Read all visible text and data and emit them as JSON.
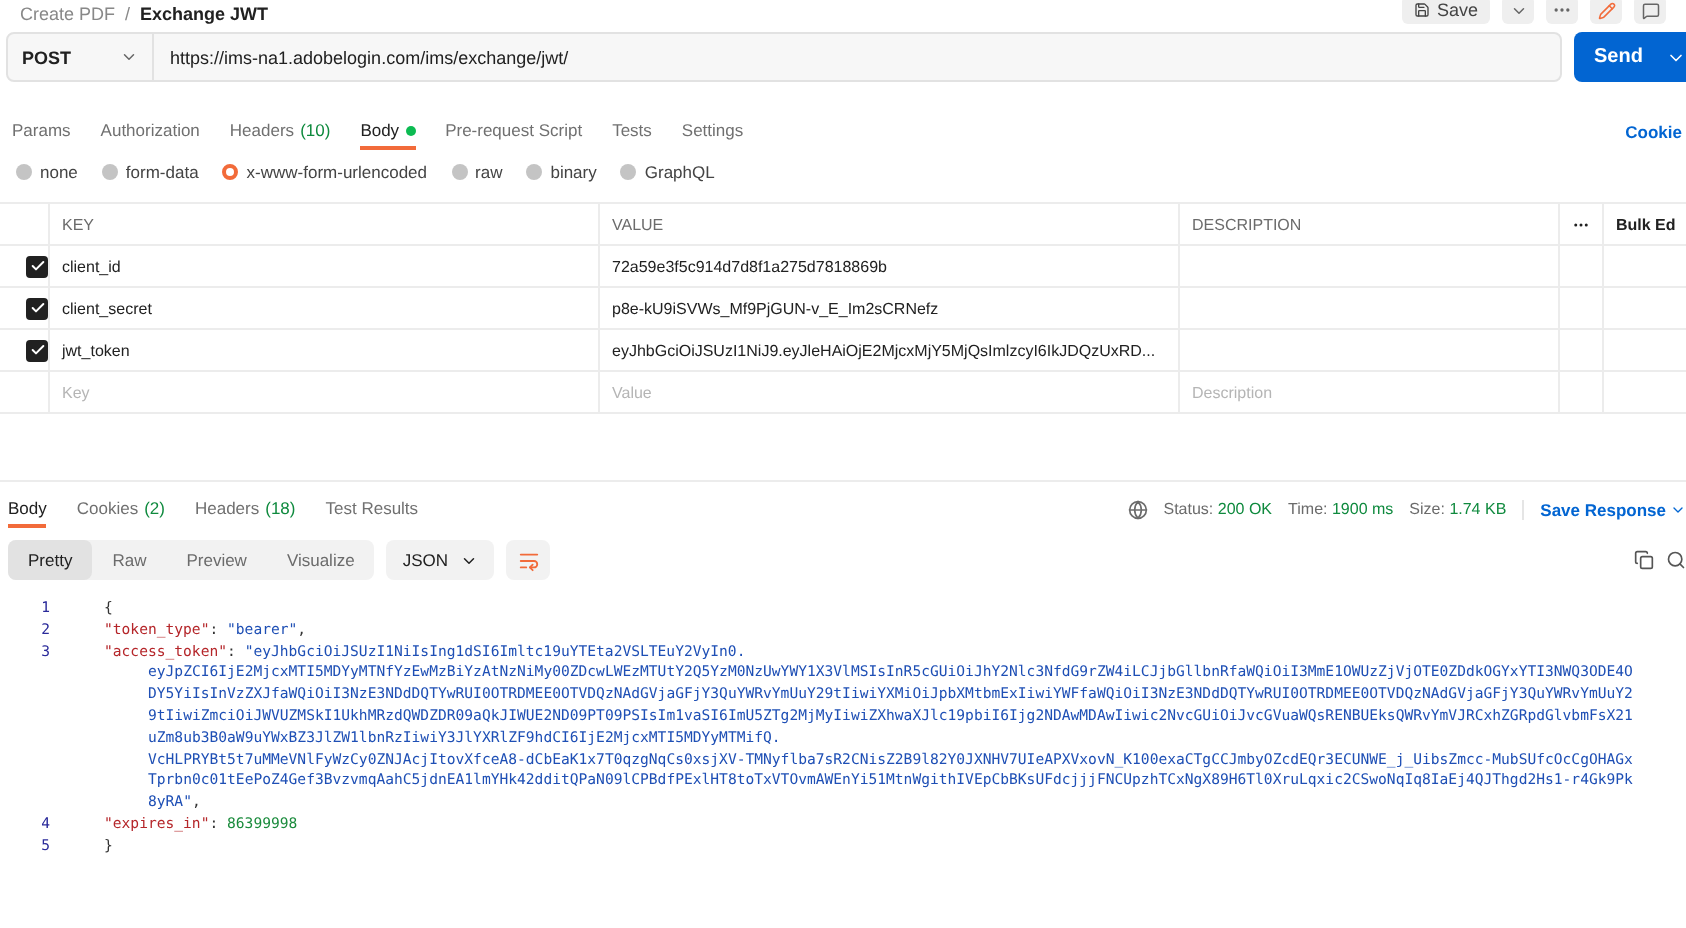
{
  "breadcrumb": {
    "parent": "Create PDF",
    "separator": "/",
    "current": "Exchange JWT"
  },
  "save_button": "Save",
  "request": {
    "method": "POST",
    "url": "https://ims-na1.adobelogin.com/ims/exchange/jwt/",
    "send": "Send"
  },
  "request_tabs": [
    {
      "label": "Params",
      "selected": false,
      "dot": false
    },
    {
      "label": "Authorization",
      "selected": false,
      "dot": false
    },
    {
      "label": "Headers",
      "count": "(10)",
      "selected": false,
      "dot": false
    },
    {
      "label": "Body",
      "selected": true,
      "dot": true
    },
    {
      "label": "Pre-request Script",
      "selected": false,
      "dot": false
    },
    {
      "label": "Tests",
      "selected": false,
      "dot": false
    },
    {
      "label": "Settings",
      "selected": false,
      "dot": false
    }
  ],
  "cookies_link": "Cookie",
  "body_types": [
    {
      "label": "none",
      "selected": false
    },
    {
      "label": "form-data",
      "selected": false
    },
    {
      "label": "x-www-form-urlencoded",
      "selected": true
    },
    {
      "label": "raw",
      "selected": false
    },
    {
      "label": "binary",
      "selected": false
    },
    {
      "label": "GraphQL",
      "selected": false
    }
  ],
  "params_table": {
    "columns": [
      "KEY",
      "VALUE",
      "DESCRIPTION"
    ],
    "bulk_edit": "Bulk Ed",
    "rows": [
      {
        "checked": true,
        "key": "client_id",
        "value": "72a59e3f5c914d7d8f1a275d7818869b"
      },
      {
        "checked": true,
        "key": "client_secret",
        "value": "p8e-kU9iSVWs_Mf9PjGUN-v_E_Im2sCRNefz"
      },
      {
        "checked": true,
        "key": "jwt_token",
        "value": "eyJhbGciOiJSUzI1NiJ9.eyJleHAiOjE2MjcxMjY5MjQsImlzcyI6IkJDQzUxRD..."
      }
    ],
    "new_row": [
      {
        "placeholder": "Key"
      },
      {
        "placeholder": "Value"
      },
      {
        "placeholder": "Description"
      }
    ]
  },
  "response_tabs": [
    {
      "label": "Body",
      "selected": true
    },
    {
      "label": "Cookies",
      "count": "(2)",
      "selected": false
    },
    {
      "label": "Headers",
      "count": "(18)",
      "selected": false
    },
    {
      "label": "Test Results",
      "selected": false
    }
  ],
  "status": {
    "status_label": "Status:",
    "status": "200 OK",
    "time_label": "Time:",
    "time": "1900 ms",
    "size_label": "Size:",
    "size": "1.74 KB"
  },
  "save_response": "Save Response",
  "view_modes": [
    {
      "label": "Pretty",
      "selected": true
    },
    {
      "label": "Raw",
      "selected": false
    },
    {
      "label": "Preview",
      "selected": false
    },
    {
      "label": "Visualize",
      "selected": false
    }
  ],
  "format": "JSON",
  "code_lines": [
    {
      "number": "1",
      "parts": [
        {
          "kind": "punct",
          "text": "{"
        }
      ]
    },
    {
      "number": "2",
      "parts": [
        {
          "kind": "key",
          "text": "\"token_type\""
        },
        {
          "kind": "punct",
          "text": ": "
        },
        {
          "kind": "string",
          "text": "\"bearer\""
        },
        {
          "kind": "punct",
          "text": ","
        }
      ]
    },
    {
      "number": "3",
      "parts": [
        {
          "kind": "key",
          "text": "\"access_token\""
        },
        {
          "kind": "punct",
          "text": ": "
        },
        {
          "kind": "string",
          "text": "\"eyJhbGciOiJSUzI1NiIsIng1dSI6Imltc19uYTEta2VSLTEuY2VyIn0."
        }
      ]
    },
    {
      "parts": [
        {
          "kind": "string",
          "text": "eyJpZCI6IjE2MjcxMTI5MDYyMTNfYzEwMzBiYzAtNzNiMy00ZDcwLWEzMTUtY2Q5YzM0NzUwYWY1X3VlMSIsInR5cGUiOiJhY2Nlc3NfdG9rZW4iLCJjbGllbnRfaWQiOiI3MmE1OWUzZjVjOTE0ZDdkOGYxYTI3NWQ3ODE4O"
        }
      ]
    },
    {
      "parts": [
        {
          "kind": "string",
          "text": "DY5YiIsInVzZXJfaWQiOiI3NzE3NDdDQTYwRUI0OTRDMEE0OTVDQzNAdGVjaGFjY3QuYWRvYmUuY29tIiwiYXMiOiJpbXMtbmExIiwiYWFfaWQiOiI3NzE3NDdDQTYwRUI0OTRDMEE0OTVDQzNAdGVjaGFjY3QuYWRvYmUuY2"
        }
      ]
    },
    {
      "parts": [
        {
          "kind": "string",
          "text": "9tIiwiZmciOiJWVUZMSkI1UkhMRzdQWDZDR09aQkJIWUE2ND09PT09PSIsIm1vaSI6ImU5ZTg2MjMyIiwiZXhwaXJlc19pbiI6Ijg2NDAwMDAwIiwic2NvcGUiOiJvcGVuaWQsRENBUEksQWRvYmVJRCxhZGRpdGlvbmFsX21"
        }
      ]
    },
    {
      "parts": [
        {
          "kind": "string",
          "text": "uZm8ub3B0aW9uYWxBZ3JlZW1lbnRzIiwiY3JlYXRlZF9hdCI6IjE2MjcxMTI5MDYyMTMifQ."
        }
      ]
    },
    {
      "parts": [
        {
          "kind": "string",
          "text": "VcHLPRYBt5t7uMMeVNlFyWzCy0ZNJAcjItovXfceA8-dCbEaK1x7T0qzgNqCs0xsjXV-TMNyflba7sR2CNisZ2B9l82Y0JXNHV7UIeAPXVxovN_K100exaCTgCCJmbyOZcdEQr3ECUNWE_j_UibsZmcc-MubSUfcOcCgOHAGx"
        }
      ]
    },
    {
      "parts": [
        {
          "kind": "string",
          "text": "Tprbn0c01tEePoZ4Gef3BvzvmqAahC5jdnEA1lmYHk42dditQPaN09lCPBdfPExlHT8toTxVTOvmAWEnYi51MtnWgithIVEpCbBKsUFdcjjjFNCUpzhTCxNgX89H6Tl0XruLqxic2CSwoNqIq8IaEj4QJThgd2Hs1-r4Gk9Pk"
        }
      ]
    },
    {
      "parts": [
        {
          "kind": "string",
          "text": "8yRA\""
        },
        {
          "kind": "punct",
          "text": ","
        }
      ]
    },
    {
      "number": "4",
      "parts": [
        {
          "kind": "key",
          "text": "\"expires_in\""
        },
        {
          "kind": "punct",
          "text": ": "
        },
        {
          "kind": "number",
          "text": "86399998"
        }
      ]
    },
    {
      "number": "5",
      "parts": [
        {
          "kind": "punct",
          "text": "}"
        }
      ]
    }
  ]
}
